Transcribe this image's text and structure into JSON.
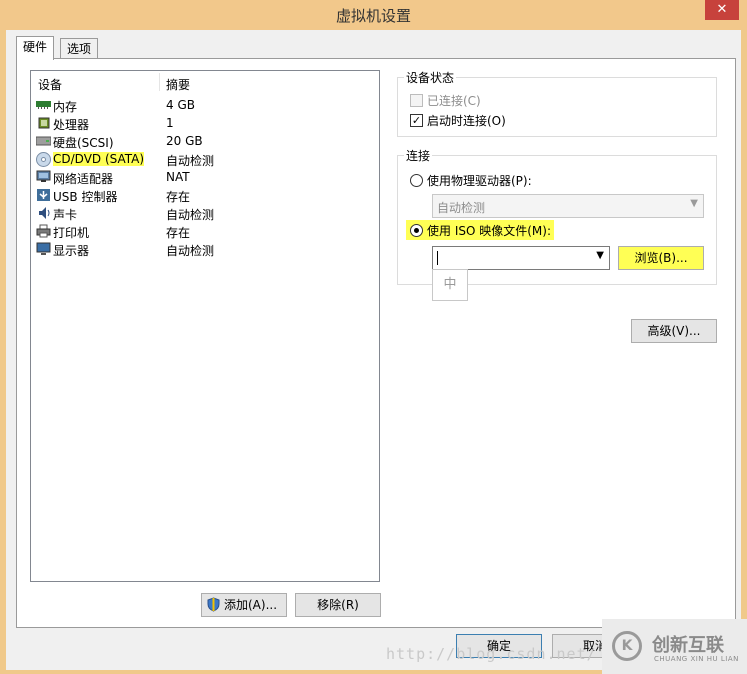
{
  "window": {
    "title": "虚拟机设置",
    "close_label": "✕"
  },
  "tabs": [
    {
      "label": "硬件"
    },
    {
      "label": "选项"
    }
  ],
  "device_list": {
    "col_device": "设备",
    "col_summary": "摘要",
    "items": [
      {
        "name": "内存",
        "summary": "4 GB",
        "icon": "memory-icon"
      },
      {
        "name": "处理器",
        "summary": "1",
        "icon": "processor-icon"
      },
      {
        "name": "硬盘(SCSI)",
        "summary": "20 GB",
        "icon": "hard-disk-icon"
      },
      {
        "name": "CD/DVD (SATA)",
        "summary": "自动检测",
        "icon": "cd-dvd-icon"
      },
      {
        "name": "网络适配器",
        "summary": "NAT",
        "icon": "network-adapter-icon"
      },
      {
        "name": "USB 控制器",
        "summary": "存在",
        "icon": "usb-icon"
      },
      {
        "name": "声卡",
        "summary": "自动检测",
        "icon": "sound-card-icon"
      },
      {
        "name": "打印机",
        "summary": "存在",
        "icon": "printer-icon"
      },
      {
        "name": "显示器",
        "summary": "自动检测",
        "icon": "display-icon"
      }
    ],
    "selected_index": 3
  },
  "buttons": {
    "add": "添加(A)...",
    "remove": "移除(R)",
    "ok": "确定",
    "cancel": "取消",
    "browse": "浏览(B)...",
    "advanced": "高级(V)..."
  },
  "device_status": {
    "legend": "设备状态",
    "connected_label": "已连接(C)",
    "connected_checked": false,
    "connect_on_start_label": "启动时连接(O)",
    "connect_on_start_checked": true
  },
  "connection": {
    "legend": "连接",
    "physical_drive_label": "使用物理驱动器(P):",
    "physical_drive_value": "自动检测",
    "iso_label": "使用 ISO 映像文件(M):",
    "iso_value": "",
    "selected": "iso"
  },
  "ime_indicator": "中",
  "watermark": "http://blog.csdn.net/",
  "brand": {
    "name_cn": "创新互联",
    "name_en": "CHUANG XIN HU LIAN",
    "logo": "K"
  },
  "colors": {
    "highlight": "#ffff55",
    "title_bar": "#f2c88b",
    "close_button": "#c7423c"
  }
}
